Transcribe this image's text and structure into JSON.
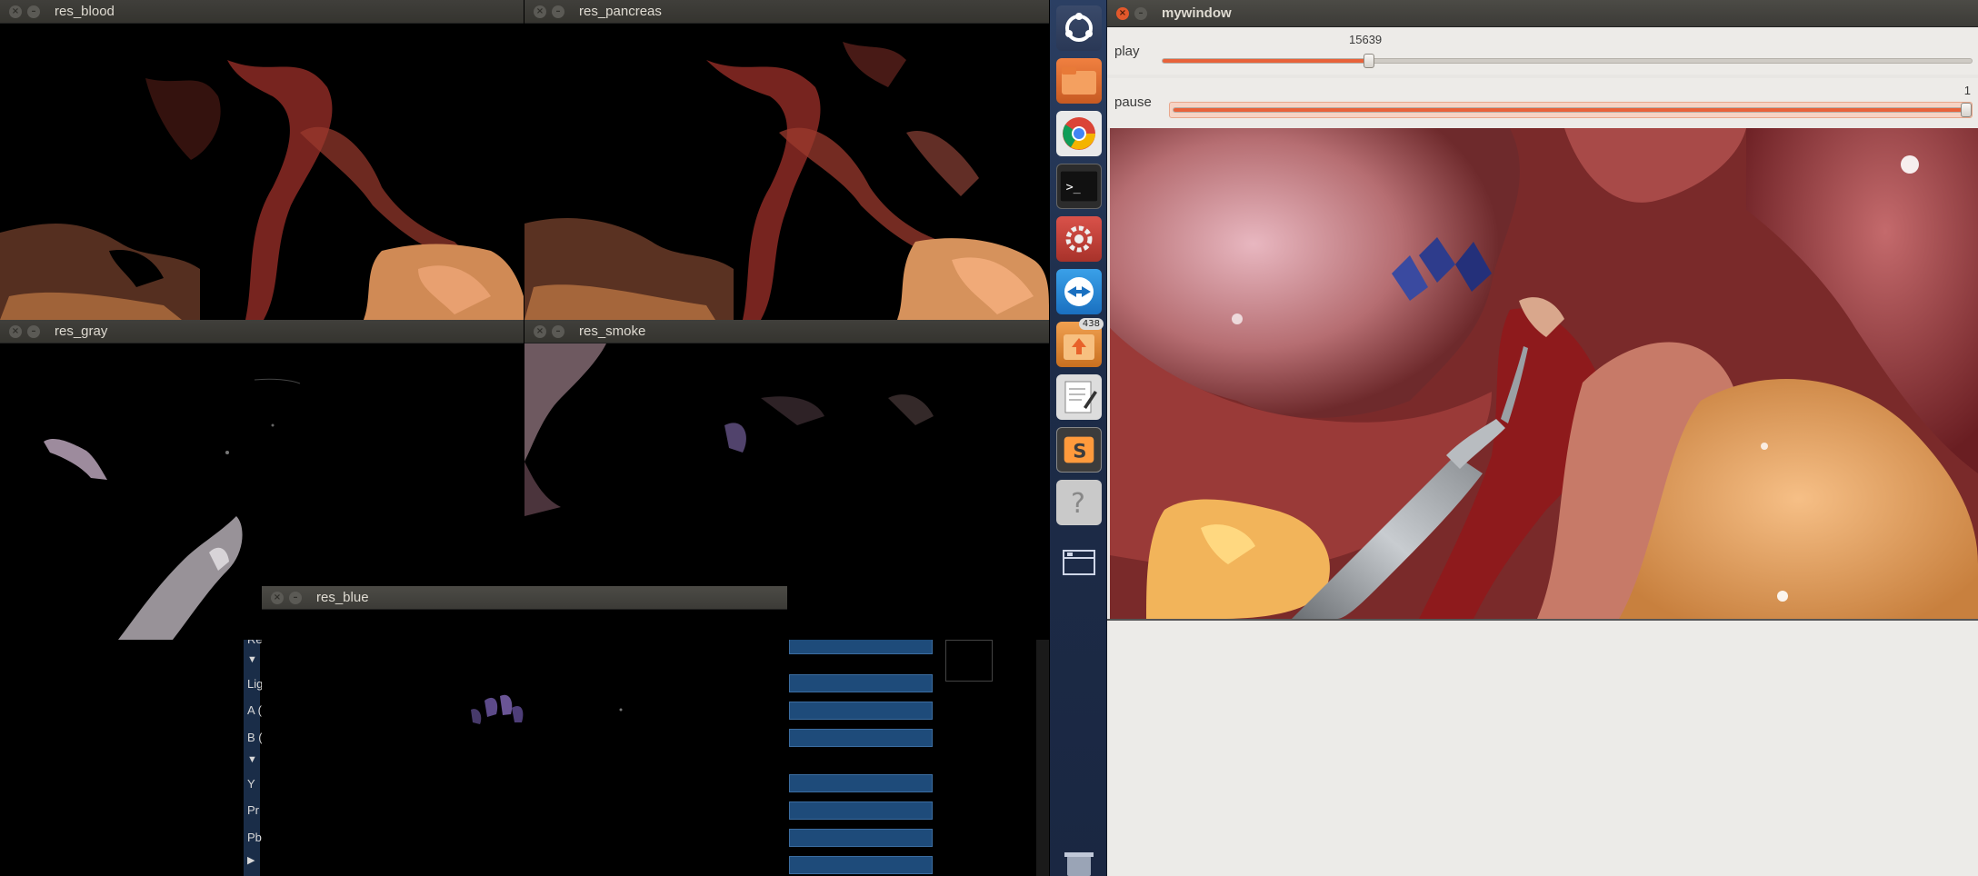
{
  "windows": {
    "res_blood": {
      "title": "res_blood"
    },
    "res_pancreas": {
      "title": "res_pancreas"
    },
    "res_gray": {
      "title": "res_gray"
    },
    "res_smoke": {
      "title": "res_smoke"
    },
    "res_blue": {
      "title": "res_blue"
    }
  },
  "background_panel": {
    "labels": [
      "Re",
      "▼",
      "Lig",
      "A (",
      "B (",
      "▼",
      "Y",
      "Pr",
      "Pb",
      "▶"
    ]
  },
  "launcher": {
    "items": [
      {
        "name": "dash-home",
        "icon": "ubuntu-logo-icon"
      },
      {
        "name": "files",
        "icon": "folder-icon"
      },
      {
        "name": "chrome",
        "icon": "chrome-icon"
      },
      {
        "name": "terminal",
        "icon": "terminal-icon",
        "glyph": ">_"
      },
      {
        "name": "system-settings",
        "icon": "gear-wrench-icon"
      },
      {
        "name": "teamviewer",
        "icon": "teamviewer-icon"
      },
      {
        "name": "software-updater",
        "icon": "update-icon",
        "badge": "438"
      },
      {
        "name": "text-editor",
        "icon": "text-editor-icon"
      },
      {
        "name": "sublime-text",
        "icon": "sublime-icon",
        "glyph": "S"
      },
      {
        "name": "help",
        "icon": "help-icon",
        "glyph": "?"
      },
      {
        "name": "workspace-switcher",
        "icon": "workspace-icon"
      },
      {
        "name": "trash",
        "icon": "trash-icon"
      }
    ]
  },
  "mywindow": {
    "title": "mywindow",
    "trackbars": [
      {
        "label": "play",
        "value": "15639",
        "position_fraction": 0.254
      },
      {
        "label": "pause",
        "value": "1",
        "position_fraction": 1.0
      }
    ]
  },
  "colors": {
    "launcher_bg": "#1d2c48",
    "slider_accent": "#e8623a",
    "titlebar": "#3c3b37"
  }
}
